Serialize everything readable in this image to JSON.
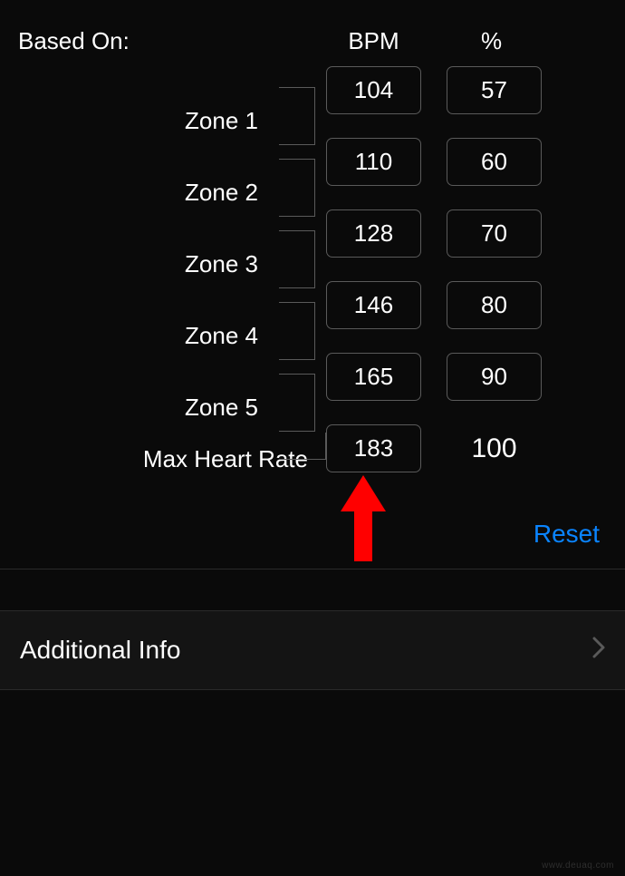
{
  "header": {
    "based_on": "Based On:",
    "bpm": "BPM",
    "percent": "%"
  },
  "zones": {
    "z1": "Zone 1",
    "z2": "Zone 2",
    "z3": "Zone 3",
    "z4": "Zone 4",
    "z5": "Zone 5",
    "max": "Max Heart Rate"
  },
  "rows": [
    {
      "bpm": "104",
      "pct": "57"
    },
    {
      "bpm": "110",
      "pct": "60"
    },
    {
      "bpm": "128",
      "pct": "70"
    },
    {
      "bpm": "146",
      "pct": "80"
    },
    {
      "bpm": "165",
      "pct": "90"
    },
    {
      "bpm": "183",
      "pct": "100"
    }
  ],
  "actions": {
    "reset": "Reset"
  },
  "additional": {
    "label": "Additional Info"
  },
  "watermark": "www.deuaq.com"
}
